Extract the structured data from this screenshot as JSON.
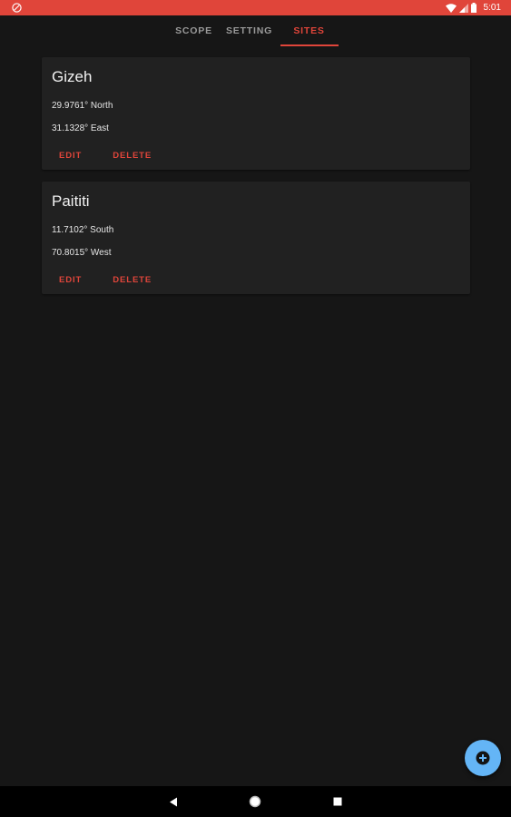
{
  "status_bar": {
    "time": "5:01",
    "color": "#e0453a"
  },
  "tabs": [
    {
      "label": "SCOPE",
      "active": false
    },
    {
      "label": "SETTING",
      "active": false
    },
    {
      "label": "SITES",
      "active": true
    }
  ],
  "sites": [
    {
      "name": "Gizeh",
      "latitude": "29.9761° North",
      "longitude": "31.1328° East",
      "edit_label": "EDIT",
      "delete_label": "DELETE"
    },
    {
      "name": "Paititi",
      "latitude": "11.7102° South",
      "longitude": "70.8015° West",
      "edit_label": "EDIT",
      "delete_label": "DELETE"
    }
  ],
  "fab": {
    "icon": "add-circle-icon",
    "color": "#64b5f6"
  },
  "nav": {
    "back_icon": "back-triangle-icon",
    "home_icon": "home-circle-icon",
    "recents_icon": "recents-square-icon"
  }
}
